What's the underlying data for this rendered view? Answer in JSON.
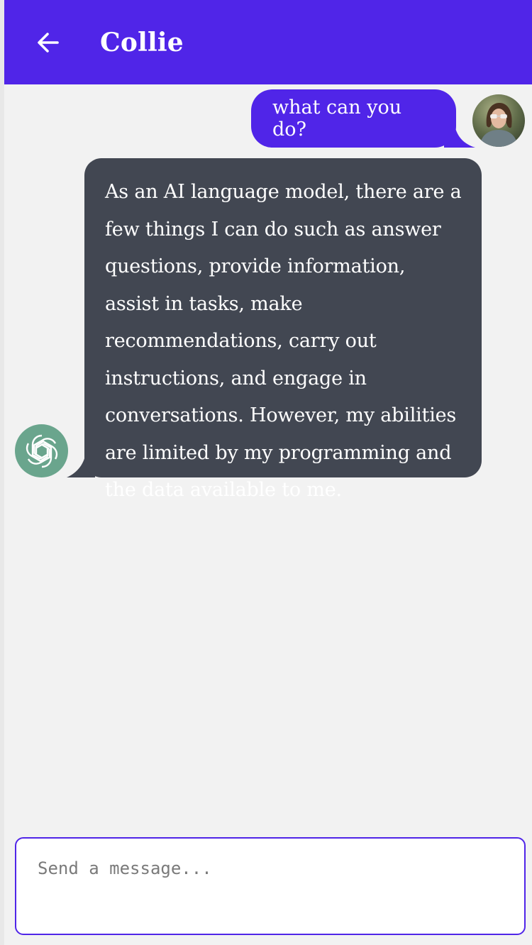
{
  "header": {
    "title": "Collie",
    "back_icon": "arrow-left-icon",
    "background": "#5025e8"
  },
  "messages": [
    {
      "role": "user",
      "text": "what can you do?",
      "avatar": "user-photo-avatar",
      "color": "#5025e8"
    },
    {
      "role": "assistant",
      "text": "As an AI language model, there are a few things I can do such as answer questions, provide information, assist in tasks, make recommendations, carry out instructions, and engage in conversations. However, my abilities are limited by my programming and the data available to me.",
      "avatar": "openai-logo-icon",
      "color": "#424752"
    }
  ],
  "composer": {
    "value": "",
    "placeholder": "Send a message..."
  }
}
